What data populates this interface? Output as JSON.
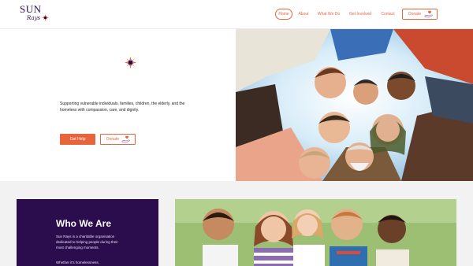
{
  "brand": {
    "name_top": "SUN",
    "name_bottom": "Rays",
    "accent": "#e8643c",
    "primary": "#2b0d4e",
    "mark_icon": "sunburst-icon"
  },
  "nav": {
    "items": [
      {
        "label": "Home",
        "active": true
      },
      {
        "label": "About"
      },
      {
        "label": "What We Do"
      },
      {
        "label": "Get Involved"
      },
      {
        "label": "Contact"
      }
    ],
    "donate_label": "Donate",
    "donate_icon": "donate-hand-icon"
  },
  "hero": {
    "tagline": "Supporting vulnerable individuals, families, children, the elderly, and the homeless with compassion, care, and dignity.",
    "get_help_label": "Get Help",
    "donate_label": "Donate",
    "photo": "group-huddle-photo"
  },
  "about": {
    "title": "Who We Are",
    "body": "Sun Rays is a charitable organisation dedicated to helping people during their most challenging moments.",
    "body2": "Whether it's homelessness,",
    "photo": "children-group-photo"
  }
}
